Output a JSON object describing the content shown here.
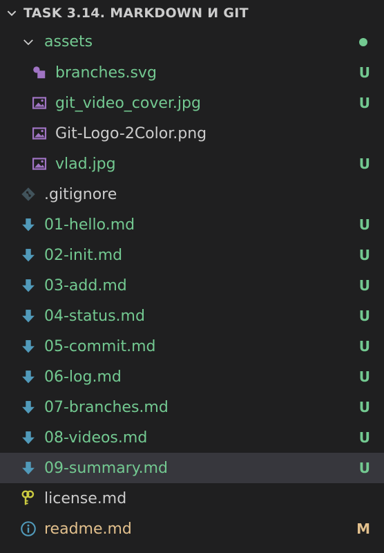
{
  "header": {
    "title": "TASK 3.14. MARKDOWN И GIT"
  },
  "colors": {
    "untracked": "#73c991",
    "modified": "#e2c08d",
    "default": "#cccccc",
    "md_icon": "#519aba",
    "image_icon": "#a074c4",
    "key_icon": "#cbcb41",
    "info_icon": "#519aba",
    "git_icon": "#41535b",
    "dot": "#73c991",
    "selected_bg": "#37373d"
  },
  "tree": [
    {
      "name": "assets",
      "type": "folder",
      "icon": "chevron-down-icon",
      "badge": "",
      "status": "folder-untracked"
    },
    {
      "name": "branches.svg",
      "type": "file",
      "icon": "svg-icon",
      "badge": "U",
      "status": "untracked"
    },
    {
      "name": "git_video_cover.jpg",
      "type": "file",
      "icon": "image-icon",
      "badge": "U",
      "status": "untracked"
    },
    {
      "name": "Git-Logo-2Color.png",
      "type": "file",
      "icon": "image-icon",
      "badge": "",
      "status": "default"
    },
    {
      "name": "vlad.jpg",
      "type": "file",
      "icon": "image-icon",
      "badge": "U",
      "status": "untracked"
    },
    {
      "name": ".gitignore",
      "type": "file",
      "icon": "git-icon",
      "badge": "",
      "status": "default"
    },
    {
      "name": "01-hello.md",
      "type": "file",
      "icon": "markdown-icon",
      "badge": "U",
      "status": "untracked"
    },
    {
      "name": "02-init.md",
      "type": "file",
      "icon": "markdown-icon",
      "badge": "U",
      "status": "untracked"
    },
    {
      "name": "03-add.md",
      "type": "file",
      "icon": "markdown-icon",
      "badge": "U",
      "status": "untracked"
    },
    {
      "name": "04-status.md",
      "type": "file",
      "icon": "markdown-icon",
      "badge": "U",
      "status": "untracked"
    },
    {
      "name": "05-commit.md",
      "type": "file",
      "icon": "markdown-icon",
      "badge": "U",
      "status": "untracked"
    },
    {
      "name": "06-log.md",
      "type": "file",
      "icon": "markdown-icon",
      "badge": "U",
      "status": "untracked"
    },
    {
      "name": "07-branches.md",
      "type": "file",
      "icon": "markdown-icon",
      "badge": "U",
      "status": "untracked"
    },
    {
      "name": "08-videos.md",
      "type": "file",
      "icon": "markdown-icon",
      "badge": "U",
      "status": "untracked"
    },
    {
      "name": "09-summary.md",
      "type": "file",
      "icon": "markdown-icon",
      "badge": "U",
      "status": "untracked",
      "selected": true
    },
    {
      "name": "license.md",
      "type": "file",
      "icon": "key-icon",
      "badge": "",
      "status": "default"
    },
    {
      "name": "readme.md",
      "type": "file",
      "icon": "info-icon",
      "badge": "M",
      "status": "modified"
    }
  ]
}
